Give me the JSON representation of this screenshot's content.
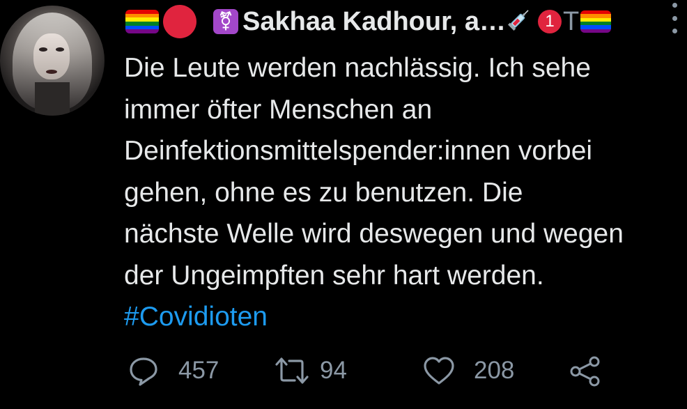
{
  "tweet": {
    "author": {
      "display_name": "Sakhaa Kadhour, a…",
      "avatar_icon": "profile-photo",
      "name_prefix_icons": [
        "rainbow-flag",
        "red-circle",
        "transgender-symbol"
      ],
      "name_suffix_icons": [
        "syringe",
        "notification-badge",
        "rainbow-flag"
      ],
      "badge_count": "1",
      "trailing_char": "T"
    },
    "text_lines": [
      "Die Leute werden nachlässig. Ich sehe",
      "immer öfter Menschen an",
      "Deinfektionsmittelspender:innen vorbei",
      "gehen, ohne es zu benutzen. Die",
      "nächste Welle wird deswegen und wegen",
      "der Ungeimpften sehr hart werden."
    ],
    "hashtag": "#Covidioten",
    "actions": {
      "reply": {
        "icon": "reply-icon",
        "count": "457"
      },
      "retweet": {
        "icon": "retweet-icon",
        "count": "94"
      },
      "like": {
        "icon": "heart-icon",
        "count": "208"
      },
      "share": {
        "icon": "share-icon"
      }
    }
  },
  "colors": {
    "background": "#000000",
    "text": "#e7e9ea",
    "muted": "#8b98a5",
    "link": "#1d9bf0",
    "badge": "#e0243e"
  }
}
